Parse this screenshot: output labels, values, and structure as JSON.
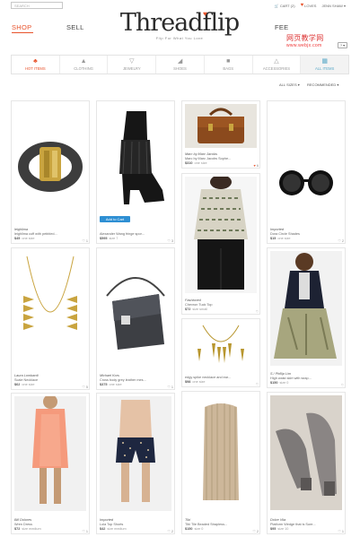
{
  "header": {
    "search_placeholder": "SEARCH",
    "cart_label": "CART (2)",
    "loves_label": "LOVES",
    "user_label": "JENN SHAW ▾",
    "logo_text": "Threadflip",
    "tagline": "Flip For What You Love",
    "nav": {
      "shop": "SHOP",
      "sell": "SELL",
      "feed": "FEE"
    },
    "help_label": "? ▾"
  },
  "watermark": {
    "line1": "网页教学网",
    "line2": "www.webjx.com"
  },
  "categories": [
    {
      "label": "HOT ITEMS",
      "icon": "flame-icon"
    },
    {
      "label": "CLOTHING",
      "icon": "dress-icon"
    },
    {
      "label": "JEWELRY",
      "icon": "necklace-icon"
    },
    {
      "label": "SHOES",
      "icon": "boot-icon"
    },
    {
      "label": "BAGS",
      "icon": "bag-icon"
    },
    {
      "label": "ACCESSORIES",
      "icon": "hanger-icon"
    },
    {
      "label": "ALL ITEMS",
      "icon": "grid-icon"
    }
  ],
  "filters": {
    "all_sizes": "ALL SIZES ▾",
    "recommended": "RECOMMENDED ▾"
  },
  "add_to_cart_label": "Add to Cart",
  "products": [
    {
      "brand": "leighlima",
      "title": "leighlima cuff with pebbled...",
      "price": "$45",
      "size": "one size",
      "likes": "1"
    },
    {
      "brand": "",
      "title": "Alexander Wang fringe spor...",
      "price": "$595",
      "size": "size 7",
      "likes": "3"
    },
    {
      "brand": "Marc by Marc Jacobs",
      "title": "Marc by Marc Jacobs Sophe...",
      "price": "$310",
      "size": "one size",
      "likes": "6"
    },
    {
      "brand": "",
      "title": "",
      "price": "",
      "size": "",
      "likes": ""
    },
    {
      "brand": "Imported",
      "title": "Dora Circle Shades",
      "price": "$15",
      "size": "one size",
      "likes": "2"
    },
    {
      "brand": "Laura Lombardi",
      "title": "Scale Necklace",
      "price": "$62",
      "size": "one size",
      "likes": "5"
    },
    {
      "brand": "Michael Kors",
      "title": "Cross body grey leather mes...",
      "price": "$375",
      "size": "one size",
      "likes": "1"
    },
    {
      "brand": "Fashioned",
      "title": "Chevron Tuck Top",
      "price": "$72",
      "size": "size small",
      "likes": ""
    },
    {
      "brand": "",
      "title": "edgy spike necklace and ear...",
      "price": "$98",
      "size": "one size",
      "likes": ""
    },
    {
      "brand": "S / Phillip Lim",
      "title": "High waist skirt with wrap...",
      "price": "$150",
      "size": "size 0",
      "likes": ""
    },
    {
      "brand": "Bill Dolores",
      "title": "Wren Dress",
      "price": "$72",
      "size": "size medium",
      "likes": "1"
    },
    {
      "brand": "Imported",
      "title": "Lola Top Shorts",
      "price": "$42",
      "size": "size medium",
      "likes": "2"
    },
    {
      "brand": "Tibi",
      "title": "Tibi Tile Beaded Strapless...",
      "price": "$150",
      "size": "size 0",
      "likes": "2"
    },
    {
      "brand": "Dolce Vita",
      "title": "Platform Wedge that is Sure...",
      "price": "$95",
      "size": "size 10",
      "likes": "1"
    }
  ]
}
